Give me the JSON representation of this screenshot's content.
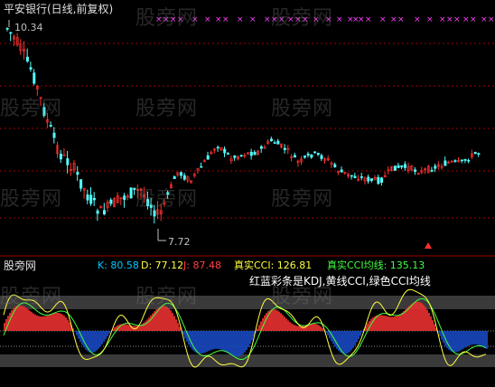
{
  "title": "平安银行(日线,前复权)",
  "price_high_label": "10.34",
  "price_low_label": "7.72",
  "subchart_name": "股旁网",
  "indicators": {
    "k_label": "K: 80.58",
    "d_label": "D: 77.12",
    "j_label": "J: 87.48",
    "cci_label": "真实CCI: 126.81",
    "cci_ma_label": "真实CCI均线: 135.13"
  },
  "note": "红蓝彩条是KDJ,黄线CCI,绿色CCI均线",
  "watermark": "股旁网",
  "colors": {
    "background": "#000000",
    "up_candle": "#ff3030",
    "down_candle": "#54ffff",
    "grid": "#a00000",
    "k_color": "#00c8ff",
    "d_color": "#ffff40",
    "j_color": "#ff4040",
    "cci_label_color": "#ffff40",
    "cci_ma_label_color": "#40ff40",
    "cci_line": "#ffff40",
    "cci_ma_line": "#40ff40",
    "fill_up": "#e83030",
    "fill_down": "#1848c0",
    "marker": "#ff40ff"
  }
}
